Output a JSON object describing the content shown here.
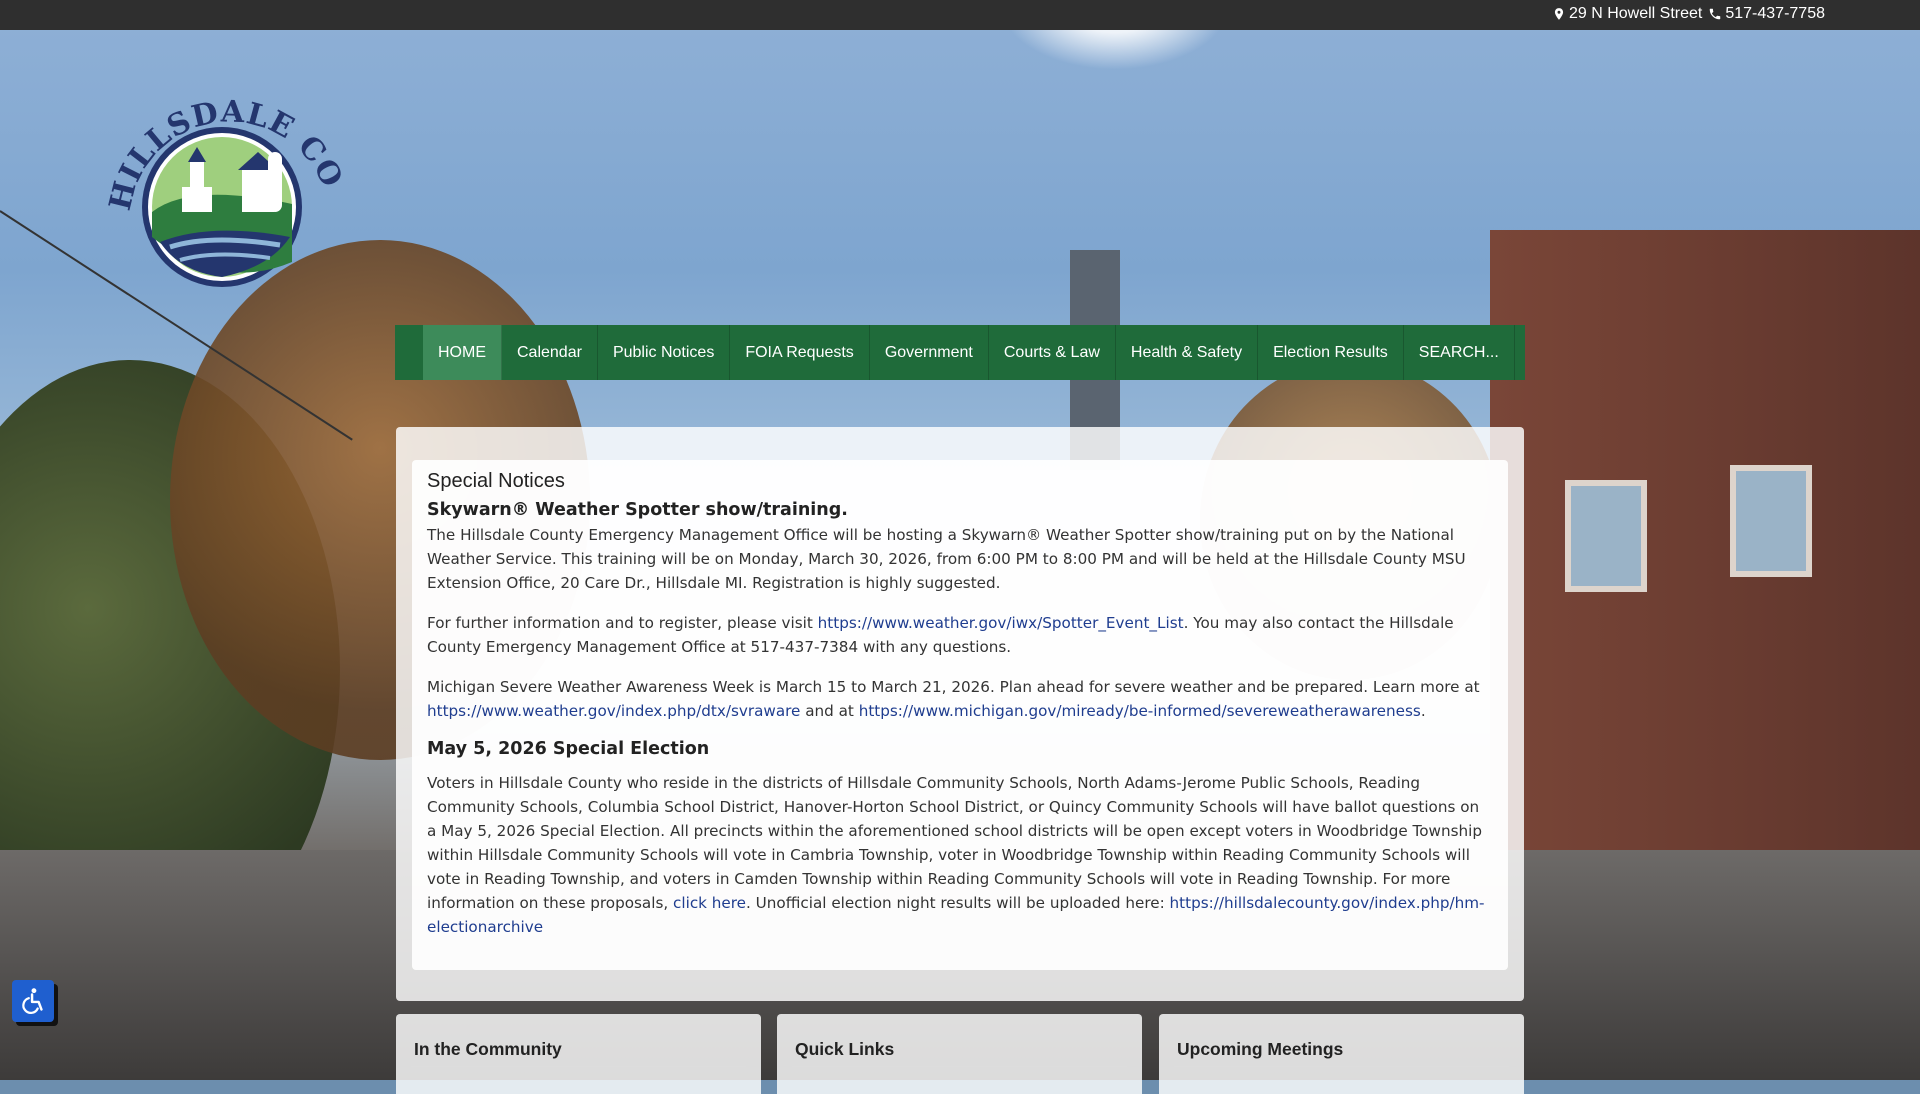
{
  "topbar": {
    "address": "29 N Howell Street",
    "phone": "517-437-7758"
  },
  "logo": {
    "text": "HILLSDALE COUNTY"
  },
  "nav": {
    "items": [
      {
        "label": "HOME"
      },
      {
        "label": "Calendar"
      },
      {
        "label": "Public Notices"
      },
      {
        "label": "FOIA Requests"
      },
      {
        "label": "Government"
      },
      {
        "label": "Courts & Law"
      },
      {
        "label": "Health & Safety"
      },
      {
        "label": "Election Results"
      },
      {
        "label": "SEARCH..."
      }
    ]
  },
  "notices": {
    "heading": "Special Notices",
    "skywarn": {
      "title": "Skywarn® Weather Spotter show/training.",
      "p1": "The Hillsdale County Emergency Management Office will be hosting a Skywarn® Weather Spotter show/training put on by the National Weather Service. This training will be on Monday, March 30, 2026, from 6:00 PM to 8:00 PM and will be held at the Hillsdale County MSU Extension Office, 20 Care Dr., Hillsdale MI. Registration is highly suggested.",
      "p2_before": "For further information and to register, please visit ",
      "p2_link": "https://www.weather.gov/iwx/Spotter_Event_List",
      "p2_after": ". You may also contact the Hillsdale County Emergency Management Office at 517-437-7384 with any questions.",
      "p3_before": "Michigan Severe Weather Awareness Week is March 15 to March 21, 2026. Plan ahead for severe weather and be prepared. Learn more at ",
      "p3_link1": "https://www.weather.gov/index.php/dtx/svraware",
      "p3_mid": " and at ",
      "p3_link2": "https://www.michigan.gov/miready/be-informed/severeweatherawareness",
      "p3_after": "."
    },
    "election": {
      "title": "May 5, 2026 Special Election",
      "p_before": "Voters in Hillsdale County who reside in the districts of Hillsdale Community Schools, North Adams-Jerome Public Schools, Reading Community Schools, Columbia School District, Hanover-Horton School District, or Quincy Community Schools will have ballot questions on a May 5, 2026 Special Election. All precincts within the aforementioned school districts will be open except voters in Woodbridge Township within Hillsdale Community Schools will vote in Cambria Township, voter in Woodbridge Township within Reading Community Schools will vote in Reading Township, and voters in Camden Township within Reading Community Schools will vote in Reading Township. For more information on these proposals, ",
      "p_link1": "click here",
      "p_mid": ". Unofficial election night results will be uploaded here: ",
      "p_link2": "https://hillsdalecounty.gov/index.php/hm-electionarchive"
    }
  },
  "bottom_cards": [
    {
      "title": "In the Community"
    },
    {
      "title": "Quick Links"
    },
    {
      "title": "Upcoming Meetings"
    }
  ],
  "colors": {
    "topbar": "#2f2f2f",
    "nav": "#1f6b3a",
    "nav_active": "#3d8b5a",
    "link": "#1f3d8f",
    "a11y": "#1f5fcf"
  },
  "icons": {
    "address": "map-marker-icon",
    "phone": "phone-icon",
    "a11y": "wheelchair-icon"
  }
}
